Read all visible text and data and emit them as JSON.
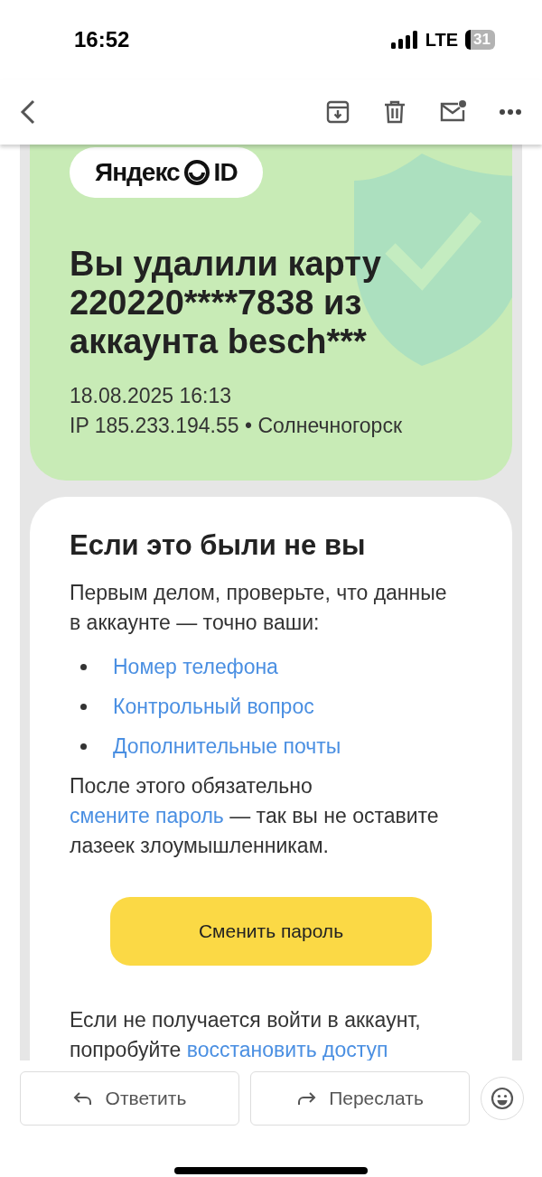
{
  "status_bar": {
    "time": "16:52",
    "network": "LTE",
    "battery": "31"
  },
  "toolbar": {
    "actions": [
      {
        "kind": "archive"
      },
      {
        "kind": "delete"
      },
      {
        "kind": "unread"
      },
      {
        "kind": "more"
      }
    ]
  },
  "email": {
    "logo": {
      "brand": "Яндекс",
      "suffix": "ID"
    },
    "title": "Вы удалили карту 220220****7838 из аккаунта besch***",
    "date": "18.08.2025 16:13",
    "location": "IP 185.233.194.55 • Солнечногорск",
    "section": {
      "heading": "Если это были не вы",
      "intro": "Первым делом, проверьте, что данные в аккаунте — точно ваши:",
      "links": [
        "Номер телефона",
        "Контрольный вопрос",
        "Дополнительные почты"
      ],
      "after": [
        {
          "kind": "text",
          "text": "После этого обязательно "
        },
        {
          "kind": "link",
          "text": "смените пароль"
        },
        {
          "kind": "text",
          "text": " — так вы не оставите лазеек злоумышленникам."
        }
      ],
      "button": "Сменить пароль",
      "footer": [
        {
          "kind": "text",
          "text": "Если не получается войти в аккаунт, попробуйте "
        },
        {
          "kind": "link",
          "text": "восстановить доступ"
        }
      ]
    }
  },
  "actions": [
    {
      "kind": "reply",
      "label": "Ответить"
    },
    {
      "kind": "forward",
      "label": "Переслать"
    }
  ]
}
